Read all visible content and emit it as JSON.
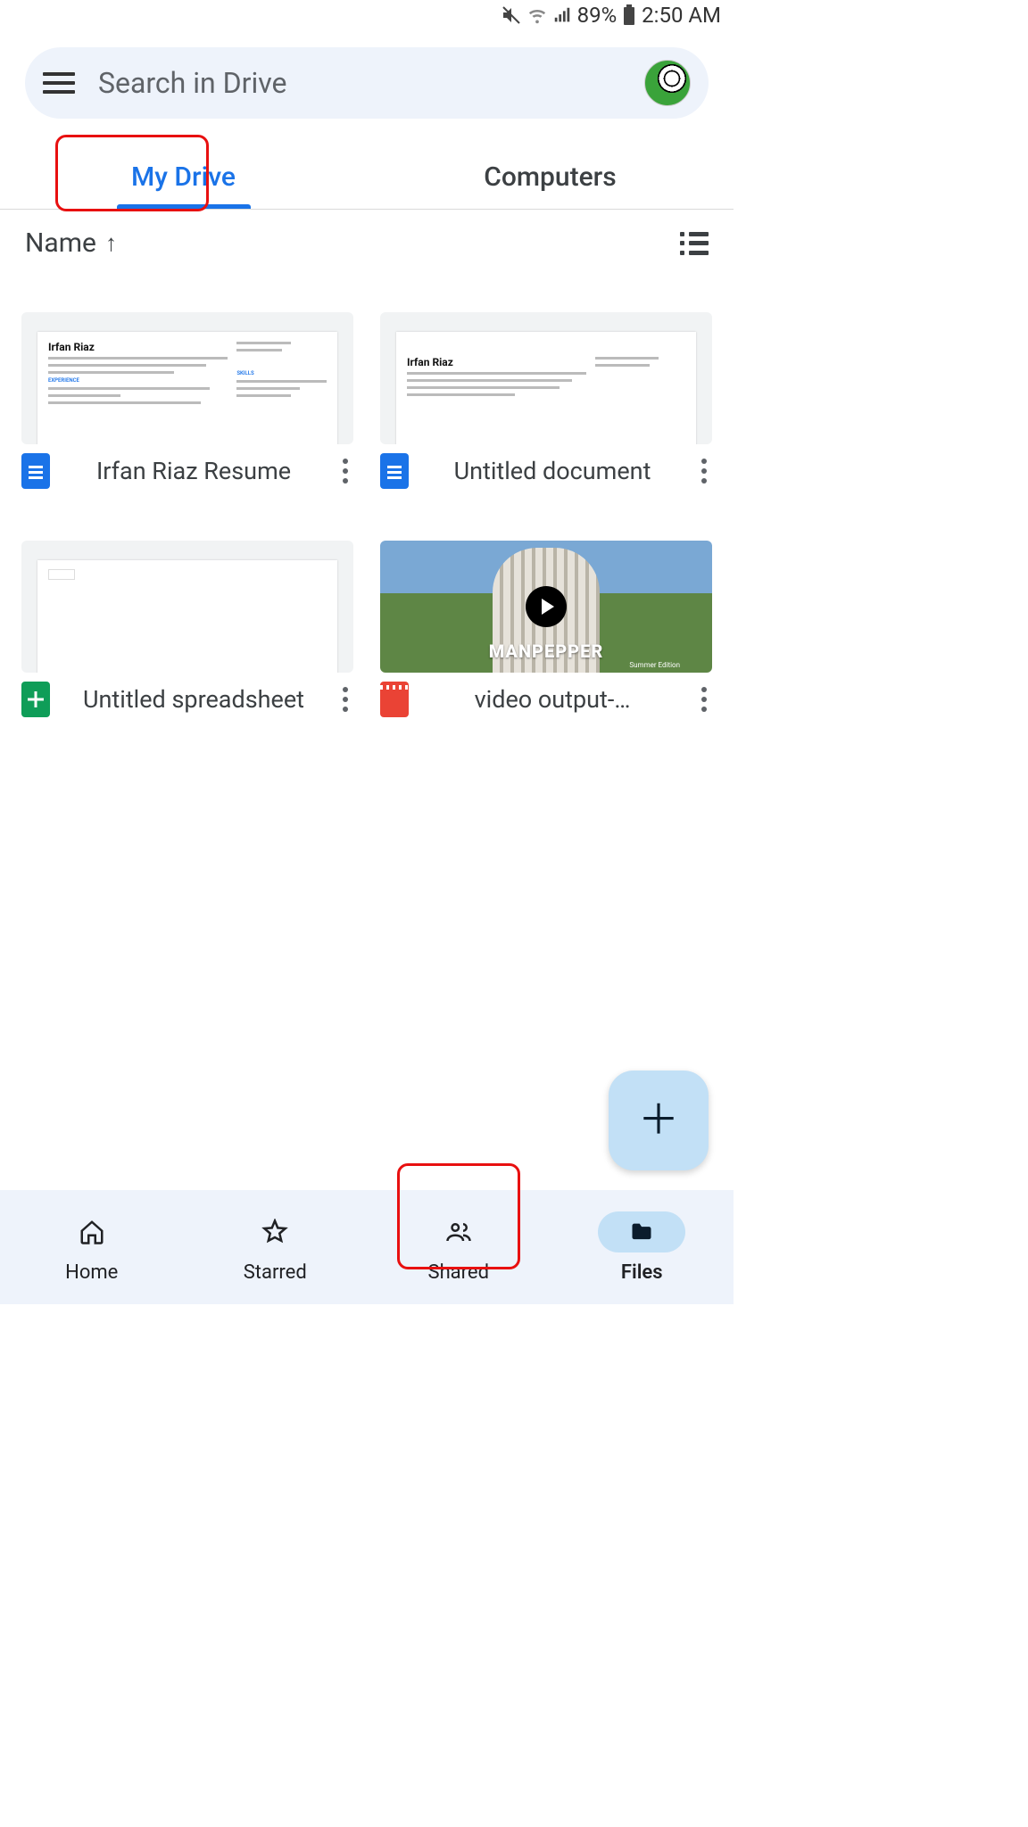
{
  "status": {
    "battery": "89%",
    "time": "2:50 AM"
  },
  "search": {
    "placeholder": "Search in Drive"
  },
  "tabs": {
    "mydrive": "My Drive",
    "computers": "Computers"
  },
  "sort": {
    "label": "Name",
    "direction": "↑"
  },
  "files": [
    {
      "name": "Irfan Riaz Resume",
      "type": "doc",
      "preview_title": "Irfan Riaz"
    },
    {
      "name": "Untitled document",
      "type": "doc",
      "preview_title": "Irfan Riaz"
    },
    {
      "name": "Untitled spreadsheet",
      "type": "sheet"
    },
    {
      "name": "video output-…",
      "type": "video",
      "overlay": "MANPEPPER",
      "overlay_sub": "Summer Edition"
    }
  ],
  "nav": {
    "home": "Home",
    "starred": "Starred",
    "shared": "Shared",
    "files": "Files"
  }
}
